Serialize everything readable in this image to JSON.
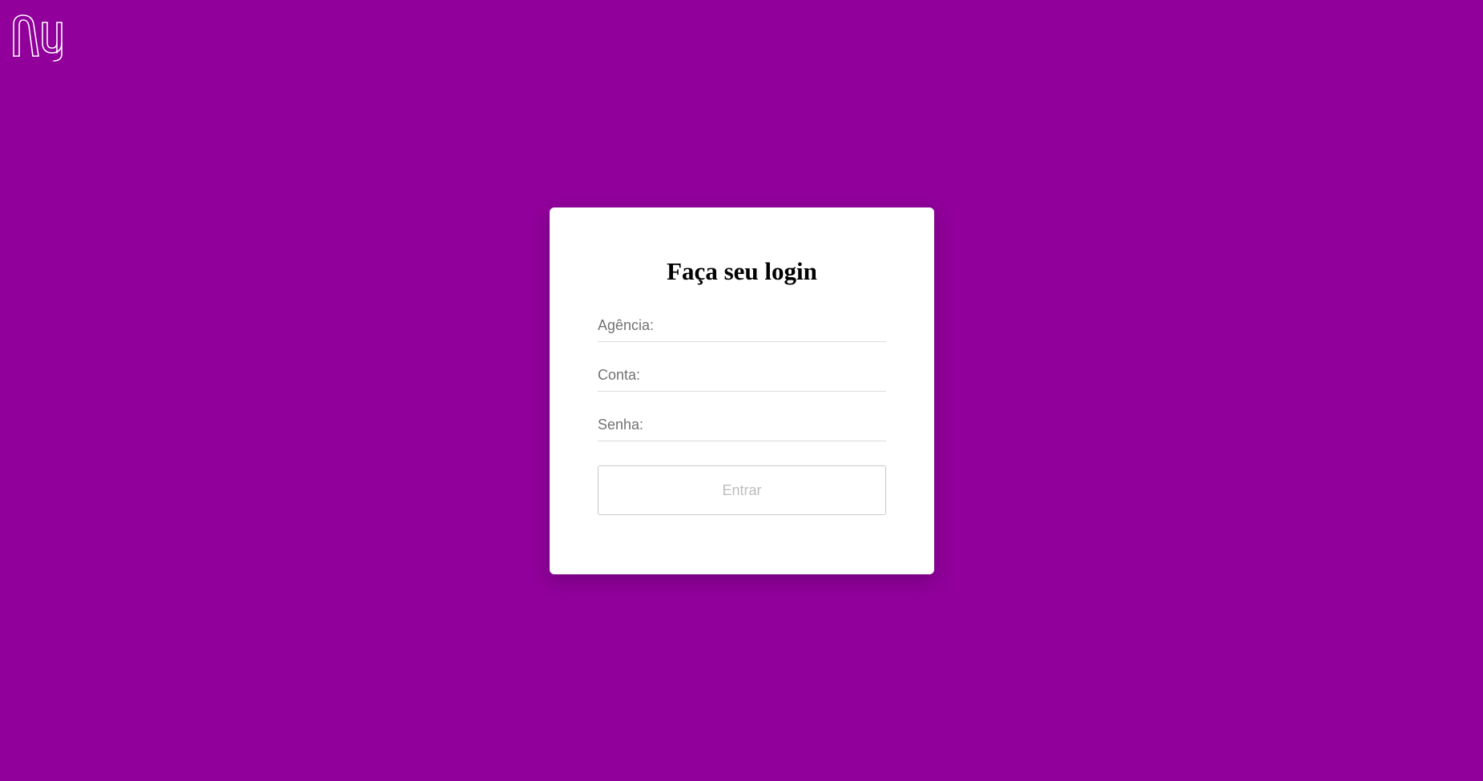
{
  "colors": {
    "background": "#91009b",
    "card": "#ffffff",
    "title": "#000000",
    "placeholder": "#737373",
    "button_text_disabled": "#bdbdbd"
  },
  "logo": {
    "icon": "nu-logo-icon"
  },
  "login": {
    "title": "Faça seu login",
    "fields": {
      "agencia": {
        "placeholder": "Agência:",
        "value": ""
      },
      "conta": {
        "placeholder": "Conta:",
        "value": ""
      },
      "senha": {
        "placeholder": "Senha:",
        "value": ""
      }
    },
    "submit_label": "Entrar",
    "submit_state": "disabled"
  }
}
